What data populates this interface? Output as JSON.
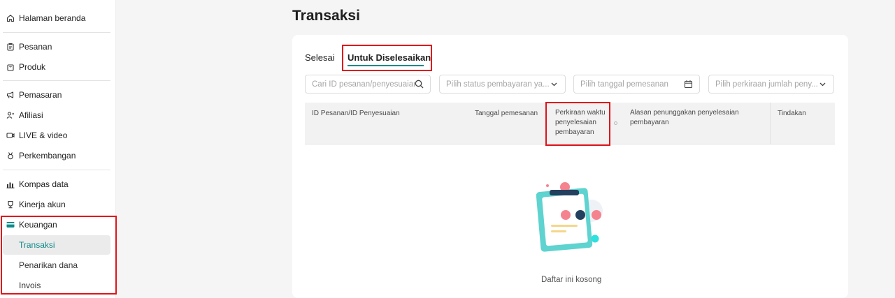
{
  "sidebar": {
    "items": [
      {
        "label": "Halaman beranda",
        "icon": "home-icon"
      },
      {
        "label": "Pesanan",
        "icon": "clipboard-icon"
      },
      {
        "label": "Produk",
        "icon": "bag-icon"
      },
      {
        "label": "Pemasaran",
        "icon": "megaphone-icon"
      },
      {
        "label": "Afiliasi",
        "icon": "users-icon"
      },
      {
        "label": "LIVE & video",
        "icon": "video-icon"
      },
      {
        "label": "Perkembangan",
        "icon": "medal-icon"
      },
      {
        "label": "Kompas data",
        "icon": "bar-chart-icon"
      },
      {
        "label": "Kinerja akun",
        "icon": "trophy-icon"
      },
      {
        "label": "Keuangan",
        "icon": "wallet-icon"
      }
    ],
    "finance_sub": [
      {
        "label": "Transaksi",
        "active": true
      },
      {
        "label": "Penarikan dana",
        "active": false
      },
      {
        "label": "Invois",
        "active": false
      }
    ]
  },
  "main": {
    "title": "Transaksi",
    "tabs": [
      {
        "label": "Selesai",
        "active": false
      },
      {
        "label": "Untuk Diselesaikan",
        "active": true
      }
    ],
    "filters": {
      "search_placeholder": "Cari ID pesanan/penyesuaian",
      "payment_status_placeholder": "Pilih status pembayaran ya...",
      "order_date_placeholder": "Pilih tanggal pemesanan",
      "estimated_amount_placeholder": "Pilih perkiraan jumlah peny..."
    },
    "table_headers": {
      "order_id": "ID Pesanan/ID Penyesuaian",
      "order_date": "Tanggal pemesanan",
      "estimated_time": "Perkiraan waktu penyelesaian pembayaran",
      "pending_reason": "Alasan penunggakan penyelesaian pembayaran",
      "actions": "Tindakan"
    },
    "empty_text": "Daftar ini kosong"
  },
  "colors": {
    "accent": "#0f8a8a",
    "highlight": "#e0141b",
    "illustration_teal": "#5ed3cf",
    "illustration_pink": "#f5838f"
  }
}
